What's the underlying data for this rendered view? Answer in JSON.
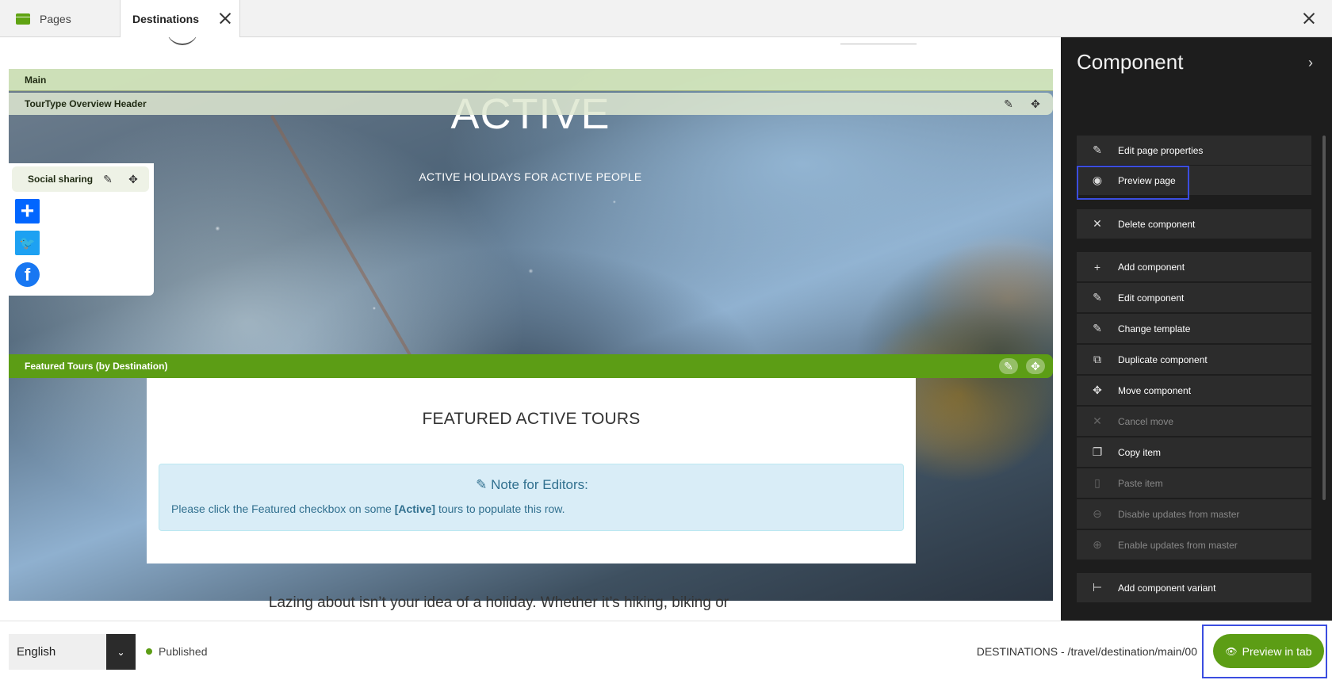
{
  "tabs": {
    "pages_label": "Pages",
    "active_label": "Destinations"
  },
  "canvas": {
    "bar_main": "Main",
    "bar_tour": "TourType Overview Header",
    "hero_title": "ACTIVE",
    "hero_subtitle": "ACTIVE HOLIDAYS FOR ACTIVE PEOPLE",
    "social_label": "Social sharing",
    "bar_featured": "Featured Tours (by Destination)",
    "featured_title": "FEATURED ACTIVE TOURS",
    "note_title": "Note for Editors:",
    "note_text_before": "Please click the Featured checkbox on some ",
    "note_text_bold": "[Active]",
    "note_text_after": " tours to populate this row.",
    "body_text": "Lazing about isn’t your idea of a holiday. Whether it’s hiking, biking or"
  },
  "side_panel": {
    "title": "Component",
    "items": [
      {
        "label": "Edit page properties",
        "icon": "pencil-icon",
        "enabled": true
      },
      {
        "label": "Preview page",
        "icon": "eye-icon",
        "enabled": true
      },
      {
        "label": "Delete component",
        "icon": "close-icon",
        "enabled": true
      },
      {
        "label": "Add component",
        "icon": "plus-icon",
        "enabled": true
      },
      {
        "label": "Edit component",
        "icon": "pencil-icon",
        "enabled": true
      },
      {
        "label": "Change template",
        "icon": "pencil-icon",
        "enabled": true
      },
      {
        "label": "Duplicate component",
        "icon": "duplicate-icon",
        "enabled": true
      },
      {
        "label": "Move component",
        "icon": "move-icon",
        "enabled": true
      },
      {
        "label": "Cancel move",
        "icon": "close-icon",
        "enabled": false
      },
      {
        "label": "Copy item",
        "icon": "copy-icon",
        "enabled": true
      },
      {
        "label": "Paste item",
        "icon": "paste-icon",
        "enabled": false
      },
      {
        "label": "Disable updates from master",
        "icon": "unlink-icon",
        "enabled": false
      },
      {
        "label": "Enable updates from master",
        "icon": "link-icon",
        "enabled": false
      },
      {
        "label": "Add component variant",
        "icon": "variant-icon",
        "enabled": true
      }
    ]
  },
  "bottom_bar": {
    "language": "English",
    "status": "Published",
    "path": "DESTINATIONS - /travel/destination/main/00",
    "preview_button": "Preview in tab"
  },
  "colors": {
    "accent_green": "#5c9d15",
    "highlight_blue": "#3b4de0",
    "panel_bg": "#1d1d1d"
  }
}
